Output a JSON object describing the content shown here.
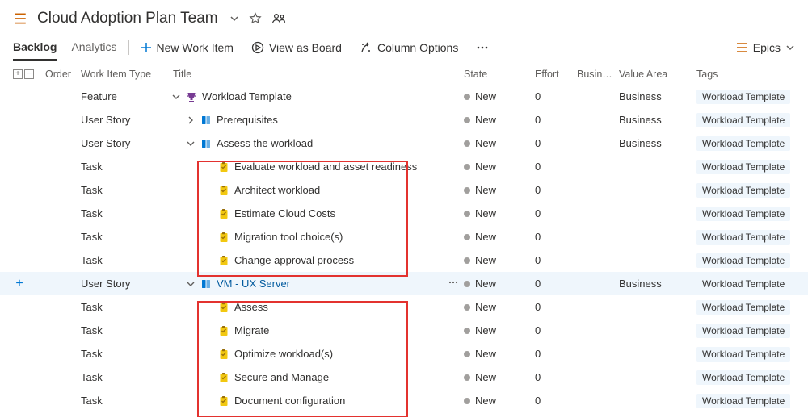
{
  "header": {
    "title": "Cloud Adoption Plan Team"
  },
  "tabs": {
    "backlog": "Backlog",
    "analytics": "Analytics"
  },
  "toolbar": {
    "new_item": "New Work Item",
    "view_as_board": "View as Board",
    "column_options": "Column Options",
    "epics": "Epics"
  },
  "columns": {
    "order": "Order",
    "work_item_type": "Work Item Type",
    "title": "Title",
    "state": "State",
    "effort": "Effort",
    "business": "Busin…",
    "value_area": "Value Area",
    "tags": "Tags"
  },
  "labels": {
    "state_new": "New",
    "value_business": "Business",
    "tag_workload_template": "Workload Template"
  },
  "rows": [
    {
      "type": "Feature",
      "title": "Workload Template",
      "icon": "trophy",
      "indent": 0,
      "exp": "down",
      "link": false,
      "effort": "0",
      "valueArea": true,
      "selected": false
    },
    {
      "type": "User Story",
      "title": "Prerequisites",
      "icon": "book",
      "indent": 1,
      "exp": "right",
      "link": false,
      "effort": "0",
      "valueArea": true,
      "selected": false
    },
    {
      "type": "User Story",
      "title": "Assess the workload",
      "icon": "book",
      "indent": 1,
      "exp": "down",
      "link": false,
      "effort": "0",
      "valueArea": true,
      "selected": false
    },
    {
      "type": "Task",
      "title": "Evaluate workload and asset readiness",
      "icon": "clipboard",
      "indent": 2,
      "exp": "",
      "link": false,
      "effort": "0",
      "valueArea": false,
      "selected": false
    },
    {
      "type": "Task",
      "title": "Architect workload",
      "icon": "clipboard",
      "indent": 2,
      "exp": "",
      "link": false,
      "effort": "0",
      "valueArea": false,
      "selected": false
    },
    {
      "type": "Task",
      "title": "Estimate Cloud Costs",
      "icon": "clipboard",
      "indent": 2,
      "exp": "",
      "link": false,
      "effort": "0",
      "valueArea": false,
      "selected": false
    },
    {
      "type": "Task",
      "title": "Migration tool choice(s)",
      "icon": "clipboard",
      "indent": 2,
      "exp": "",
      "link": false,
      "effort": "0",
      "valueArea": false,
      "selected": false
    },
    {
      "type": "Task",
      "title": "Change approval process",
      "icon": "clipboard",
      "indent": 2,
      "exp": "",
      "link": false,
      "effort": "0",
      "valueArea": false,
      "selected": false
    },
    {
      "type": "User Story",
      "title": "VM - UX Server",
      "icon": "book",
      "indent": 1,
      "exp": "down",
      "link": true,
      "effort": "0",
      "valueArea": true,
      "selected": true
    },
    {
      "type": "Task",
      "title": "Assess",
      "icon": "clipboard",
      "indent": 2,
      "exp": "",
      "link": false,
      "effort": "0",
      "valueArea": false,
      "selected": false
    },
    {
      "type": "Task",
      "title": "Migrate",
      "icon": "clipboard",
      "indent": 2,
      "exp": "",
      "link": false,
      "effort": "0",
      "valueArea": false,
      "selected": false
    },
    {
      "type": "Task",
      "title": "Optimize workload(s)",
      "icon": "clipboard",
      "indent": 2,
      "exp": "",
      "link": false,
      "effort": "0",
      "valueArea": false,
      "selected": false
    },
    {
      "type": "Task",
      "title": "Secure and Manage",
      "icon": "clipboard",
      "indent": 2,
      "exp": "",
      "link": false,
      "effort": "0",
      "valueArea": false,
      "selected": false
    },
    {
      "type": "Task",
      "title": "Document configuration",
      "icon": "clipboard",
      "indent": 2,
      "exp": "",
      "link": false,
      "effort": "0",
      "valueArea": false,
      "selected": false
    }
  ]
}
